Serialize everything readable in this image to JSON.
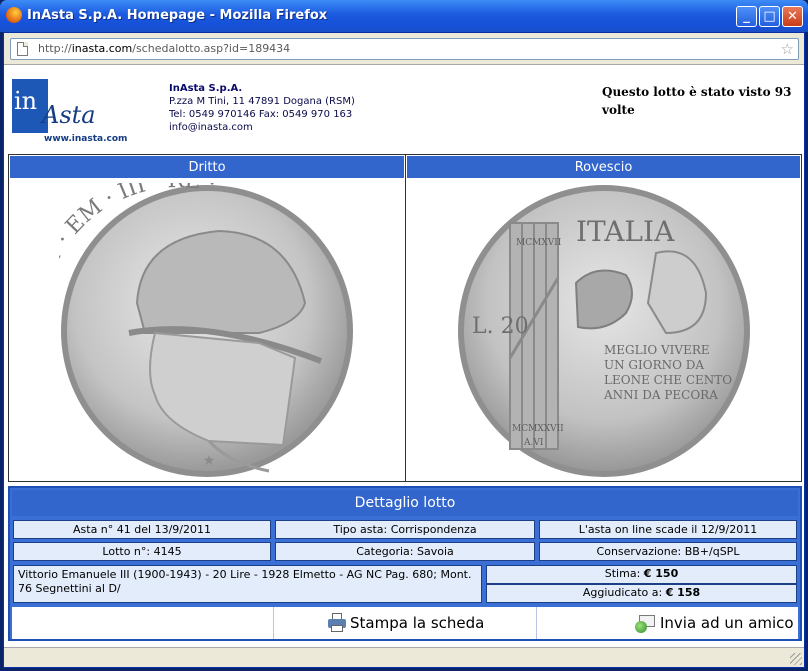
{
  "window": {
    "title": "InAsta S.p.A. Homepage - Mozilla Firefox",
    "minimize_glyph": "_",
    "maximize_glyph": "□",
    "close_glyph": "✕"
  },
  "urlbar": {
    "url_prefix": "http://",
    "url_domain": "inasta.com",
    "url_path": "/schedalotto.asp?id=189434"
  },
  "header": {
    "logo_in": "in",
    "logo_asta": "Asta",
    "logo_www": "www.inasta.com",
    "company_name": "InAsta S.p.A.",
    "address": "P.zza M Tini, 11 47891 Dogana (RSM)",
    "phone": "Tel: 0549 970146 Fax: 0549 970 163",
    "email": "info@inasta.com",
    "views_text": "Questo lotto è stato visto 93 volte"
  },
  "coins": {
    "obverse_label": "Dritto",
    "reverse_label": "Rovescio",
    "obverse_legend": "VITT · EM · III · RE ·",
    "reverse_country": "ITALIA",
    "reverse_value": "L. 20",
    "reverse_year_top": "MCMXVII",
    "reverse_year_bottom": "MCMXXVII",
    "reverse_anno": "A.VI",
    "reverse_motto": "MEGLIO VIVERE UN GIORNO DA LEONE CHE CENTO ANNI DA PECORA"
  },
  "details": {
    "title": "Dettaglio lotto",
    "asta": "Asta n° 41 del 13/9/2011",
    "tipo_asta": "Tipo asta: Corrispondenza",
    "scadenza": "L'asta on line scade il 12/9/2011",
    "lotto": "Lotto n°: 4145",
    "categoria": "Categoria: Savoia",
    "conservazione": "Conservazione: BB+/qSPL",
    "description": "Vittorio Emanuele III (1900-1943) - 20 Lire - 1928 Elmetto - AG NC Pag. 680; Mont. 76 Segnettini al D/",
    "stima_label": "Stima:",
    "stima_value": "€ 150",
    "aggiudicato_label": "Aggiudicato a:",
    "aggiudicato_value": "€ 158"
  },
  "actions": {
    "print_label": "Stampa la scheda",
    "send_label": "Invia ad un amico"
  }
}
